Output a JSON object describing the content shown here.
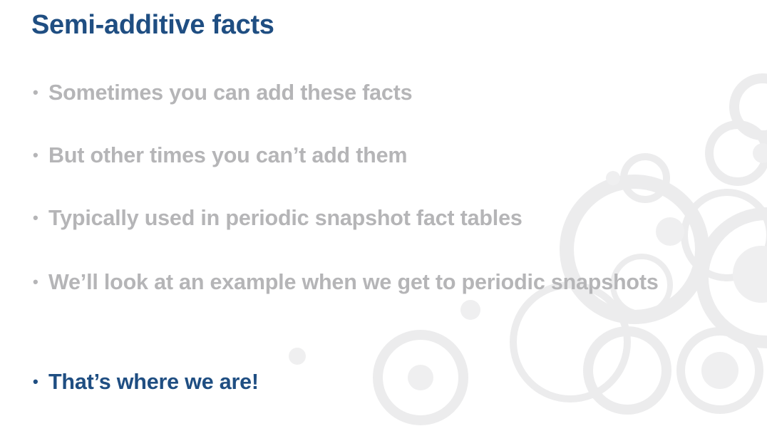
{
  "slide": {
    "title": "Semi-additive facts",
    "bullets": [
      {
        "text": "Sometimes you can add these facts"
      },
      {
        "text": "But other times you can’t add them"
      },
      {
        "text": "Typically used in periodic snapshot fact tables"
      },
      {
        "text": "We’ll look at an example when we get to periodic snapshots"
      },
      {
        "text": "That’s where we are!"
      }
    ],
    "bullet_glyph": "•",
    "colors": {
      "title": "#1f4e82",
      "muted_bullet": "#b5b5b7",
      "current_bullet": "#1f4e82"
    }
  }
}
